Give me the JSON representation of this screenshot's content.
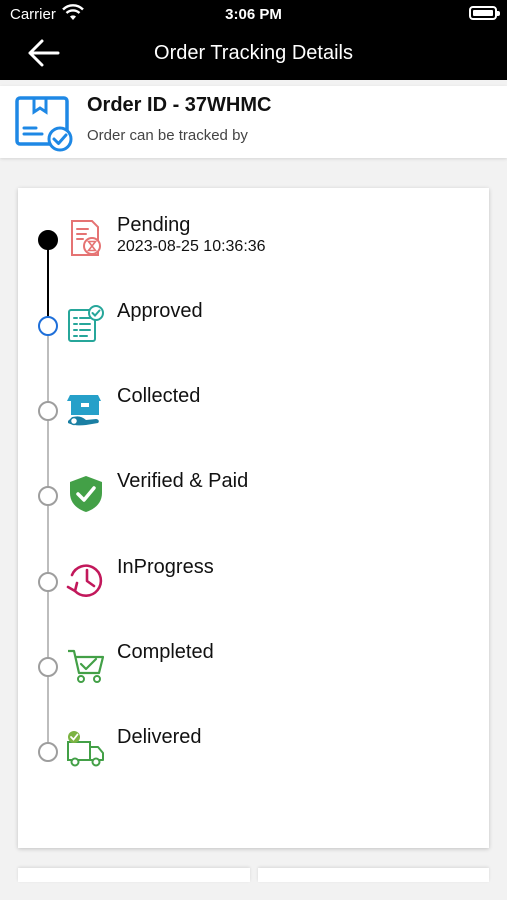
{
  "status_bar": {
    "carrier": "Carrier",
    "time": "3:06 PM"
  },
  "header": {
    "title": "Order Tracking Details",
    "back_icon": "arrow-left-icon"
  },
  "order": {
    "id_label": "Order ID - 37WHMC",
    "subtitle": "Order can be tracked by",
    "icon": "package-check-icon",
    "accent": "#1e88e5"
  },
  "timeline": {
    "steps": [
      {
        "label": "Pending",
        "date": "2023-08-25 10:36:36",
        "state": "done",
        "icon": "pending-document-icon"
      },
      {
        "label": "Approved",
        "state": "current",
        "icon": "approved-checklist-icon"
      },
      {
        "label": "Collected",
        "state": "upcoming",
        "icon": "collected-box-icon"
      },
      {
        "label": "Verified & Paid",
        "state": "upcoming",
        "icon": "verified-shield-icon"
      },
      {
        "label": "InProgress",
        "state": "upcoming",
        "icon": "in-progress-clock-icon"
      },
      {
        "label": "Completed",
        "state": "upcoming",
        "icon": "completed-cart-icon"
      },
      {
        "label": "Delivered",
        "state": "upcoming",
        "icon": "delivered-truck-icon"
      }
    ],
    "colors": {
      "done": "#000000",
      "current": "#1e6fd9",
      "upcoming": "#9e9e9e"
    }
  }
}
